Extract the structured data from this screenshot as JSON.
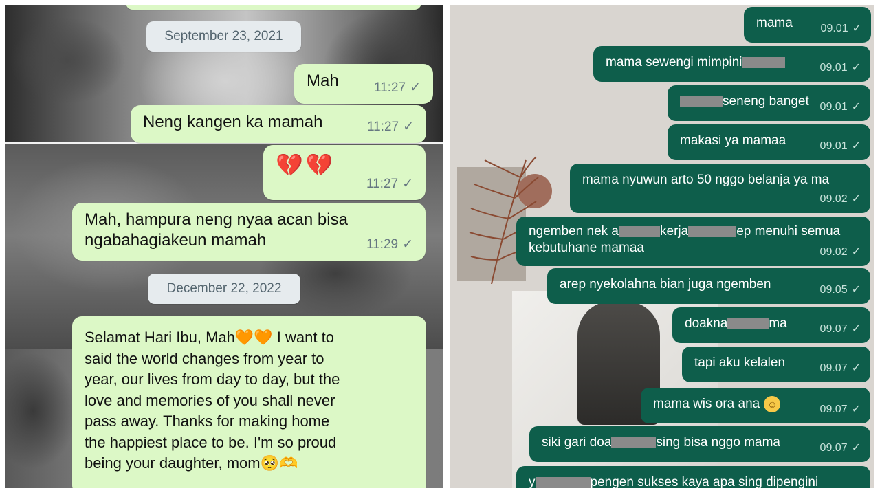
{
  "left_chat": {
    "dates": [
      "September 23, 2021",
      "December 22, 2022"
    ],
    "messages": [
      {
        "text": "Mah",
        "time": "11:27"
      },
      {
        "text": "Neng kangen ka mamah",
        "time": "11:27"
      },
      {
        "text": "💔💔",
        "time": "11:27"
      },
      {
        "line1": "Mah, hampura neng nyaa acan bisa",
        "line2": "ngabahagiakeun mamah",
        "time": "11:29"
      },
      {
        "lines": [
          "Selamat Hari Ibu, Mah🧡🧡 I want to",
          "said the world changes from year to",
          "year, our lives from day to day, but the",
          "love and memories of you shall never",
          "pass away. Thanks for making home",
          "the happiest place to be. I'm so proud",
          "being your daughter, mom🥺🫶"
        ]
      }
    ]
  },
  "right_chat": {
    "messages": [
      {
        "text": "mama",
        "time": "09.01"
      },
      {
        "text": "mama sewengi mimpini",
        "time": "09.01"
      },
      {
        "text": "seneng banget",
        "time": "09.01"
      },
      {
        "text": "makasi ya mamaa",
        "time": "09.01"
      },
      {
        "text": "mama nyuwun arto 50 nggo belanja ya ma",
        "time": "09.02"
      },
      {
        "line1_a": "ngemben nek a",
        "line1_b": "kerja",
        "line1_c": "ep menuhi semua",
        "line2": "kebutuhane mamaa",
        "time": "09.02"
      },
      {
        "text": "arep nyekolahna bian juga ngemben",
        "time": "09.05"
      },
      {
        "text_a": "doakna",
        "text_b": "ma",
        "time": "09.07"
      },
      {
        "text": "tapi aku kelalen",
        "time": "09.07"
      },
      {
        "text": "mama wis ora ana",
        "time": "09.07"
      },
      {
        "text_a": "siki gari doa",
        "text_b": "sing bisa nggo mama",
        "time": "09.07"
      },
      {
        "text_a": "y",
        "text_b": "pengen sukses kaya apa sing dipengini"
      }
    ]
  },
  "icons": {
    "read_check": "✓",
    "relieved_face": "☺"
  },
  "colors": {
    "left_bubble": "#dcf8c6",
    "right_bubble": "#0e5e4b",
    "date_pill": "#e6ebee"
  }
}
